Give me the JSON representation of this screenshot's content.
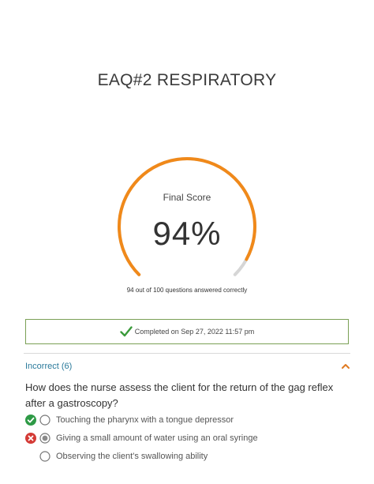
{
  "page": {
    "title": "EAQ#2 RESPIRATORY"
  },
  "score": {
    "label": "Final Score",
    "percent_text": "94%",
    "percent_value": 94,
    "subtext": "94 out of 100 questions answered correctly",
    "correct": 94,
    "total": 100
  },
  "status": {
    "completed_text": "Completed on Sep 27, 2022 11:57 pm"
  },
  "section": {
    "title": "Incorrect (6)"
  },
  "question": {
    "text": "How does the nurse assess the client for the return of the gag reflex after a gastroscopy?",
    "answers": [
      {
        "text": "Touching the pharynx with a tongue depressor",
        "mark": "correct",
        "selected": false
      },
      {
        "text": "Giving a small amount of water using an oral syringe",
        "mark": "incorrect",
        "selected": true
      },
      {
        "text": "Observing the client's swallowing ability",
        "mark": "none",
        "selected": false
      }
    ]
  },
  "colors": {
    "gauge_fill": "#f0891a",
    "gauge_track": "#d6d6d6",
    "completed_border": "#7aa055",
    "check_green": "#3a9a3a",
    "section_title": "#2a7a9b",
    "correct_badge": "#2e9a46",
    "incorrect_badge": "#d43b36"
  },
  "icons": {
    "completed": "checkmark-icon",
    "section_toggle": "chevron-up-icon",
    "correct": "check-circle-icon",
    "incorrect": "x-circle-icon"
  }
}
